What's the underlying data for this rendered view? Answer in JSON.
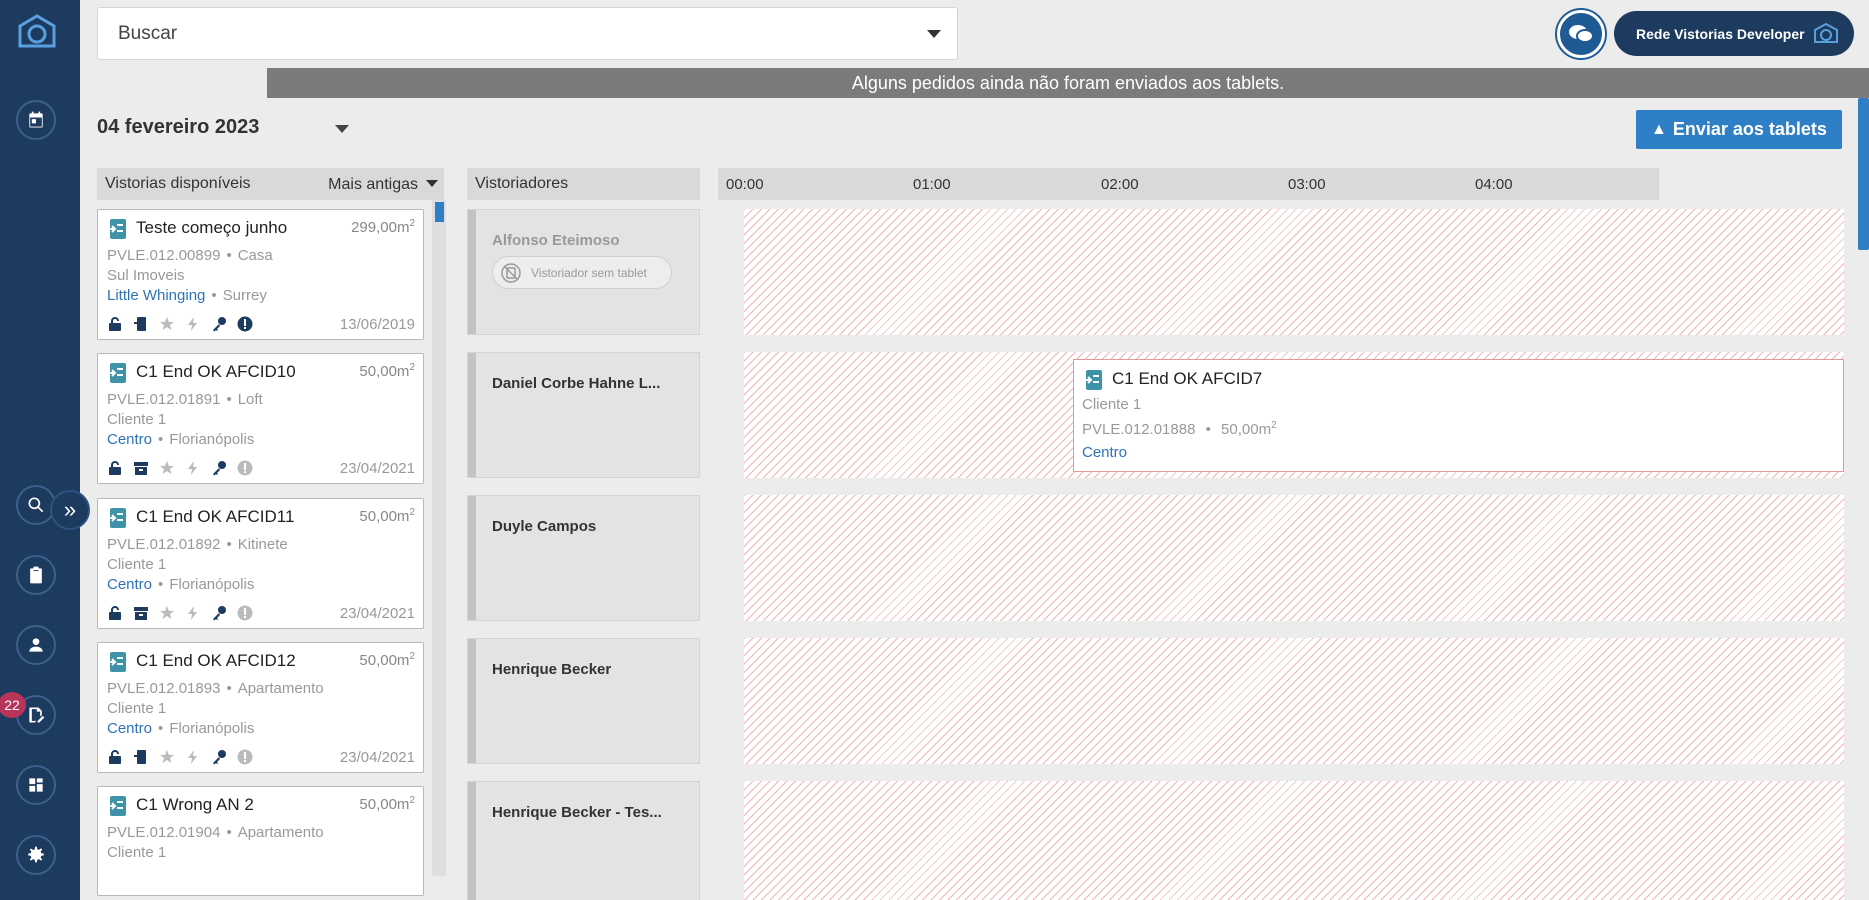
{
  "search": {
    "placeholder": "Buscar"
  },
  "account": {
    "name": "Rede Vistorias Developer"
  },
  "sidebar": {
    "badge_count": "22"
  },
  "banner": {
    "text": "Alguns pedidos ainda não foram enviados aos tablets."
  },
  "date": {
    "label": "04 fevereiro 2023"
  },
  "send_button": {
    "label": "Enviar aos tablets"
  },
  "available": {
    "header": "Vistorias disponíveis",
    "sort": "Mais antigas",
    "cards": [
      {
        "title": "Teste começo junho",
        "area": "299,00m",
        "code": "PVLE.012.00899",
        "type": "Casa",
        "client": "Sul Imoveis",
        "district": "Little Whinging",
        "city": "Surrey",
        "date": "13/06/2019"
      },
      {
        "title": "C1 End OK AFCID10",
        "area": "50,00m",
        "code": "PVLE.012.01891",
        "type": "Loft",
        "client": "Cliente 1",
        "district": "Centro",
        "city": "Florianópolis",
        "date": "23/04/2021"
      },
      {
        "title": "C1 End OK AFCID11",
        "area": "50,00m",
        "code": "PVLE.012.01892",
        "type": "Kitinete",
        "client": "Cliente 1",
        "district": "Centro",
        "city": "Florianópolis",
        "date": "23/04/2021"
      },
      {
        "title": "C1 End OK AFCID12",
        "area": "50,00m",
        "code": "PVLE.012.01893",
        "type": "Apartamento",
        "client": "Cliente 1",
        "district": "Centro",
        "city": "Florianópolis",
        "date": "23/04/2021"
      },
      {
        "title": "C1 Wrong AN 2",
        "area": "50,00m",
        "code": "PVLE.012.01904",
        "type": "Apartamento",
        "client": "Cliente 1"
      }
    ],
    "area_exp": "2"
  },
  "inspectors": {
    "header": "Vistoriadores",
    "rows": [
      {
        "name": "Alfonso Eteimoso",
        "tag": "Vistoriador sem tablet"
      },
      {
        "name": "Daniel Corbe Hahne L..."
      },
      {
        "name": "Duyle Campos"
      },
      {
        "name": "Henrique Becker"
      },
      {
        "name": "Henrique Becker - Tes..."
      }
    ]
  },
  "timeline": {
    "ticks": [
      "00:00",
      "01:00",
      "02:00",
      "03:00",
      "04:00"
    ]
  },
  "event": {
    "title": "C1 End OK AFCID7",
    "client": "Cliente 1",
    "code": "PVLE.012.01888",
    "area": "50,00m",
    "area_exp": "2",
    "district": "Centro"
  },
  "colors": {
    "sidebar": "#1d3a5f",
    "accent": "#2f7fc6",
    "banner": "#7b7b7b",
    "link": "#2e73b8"
  }
}
